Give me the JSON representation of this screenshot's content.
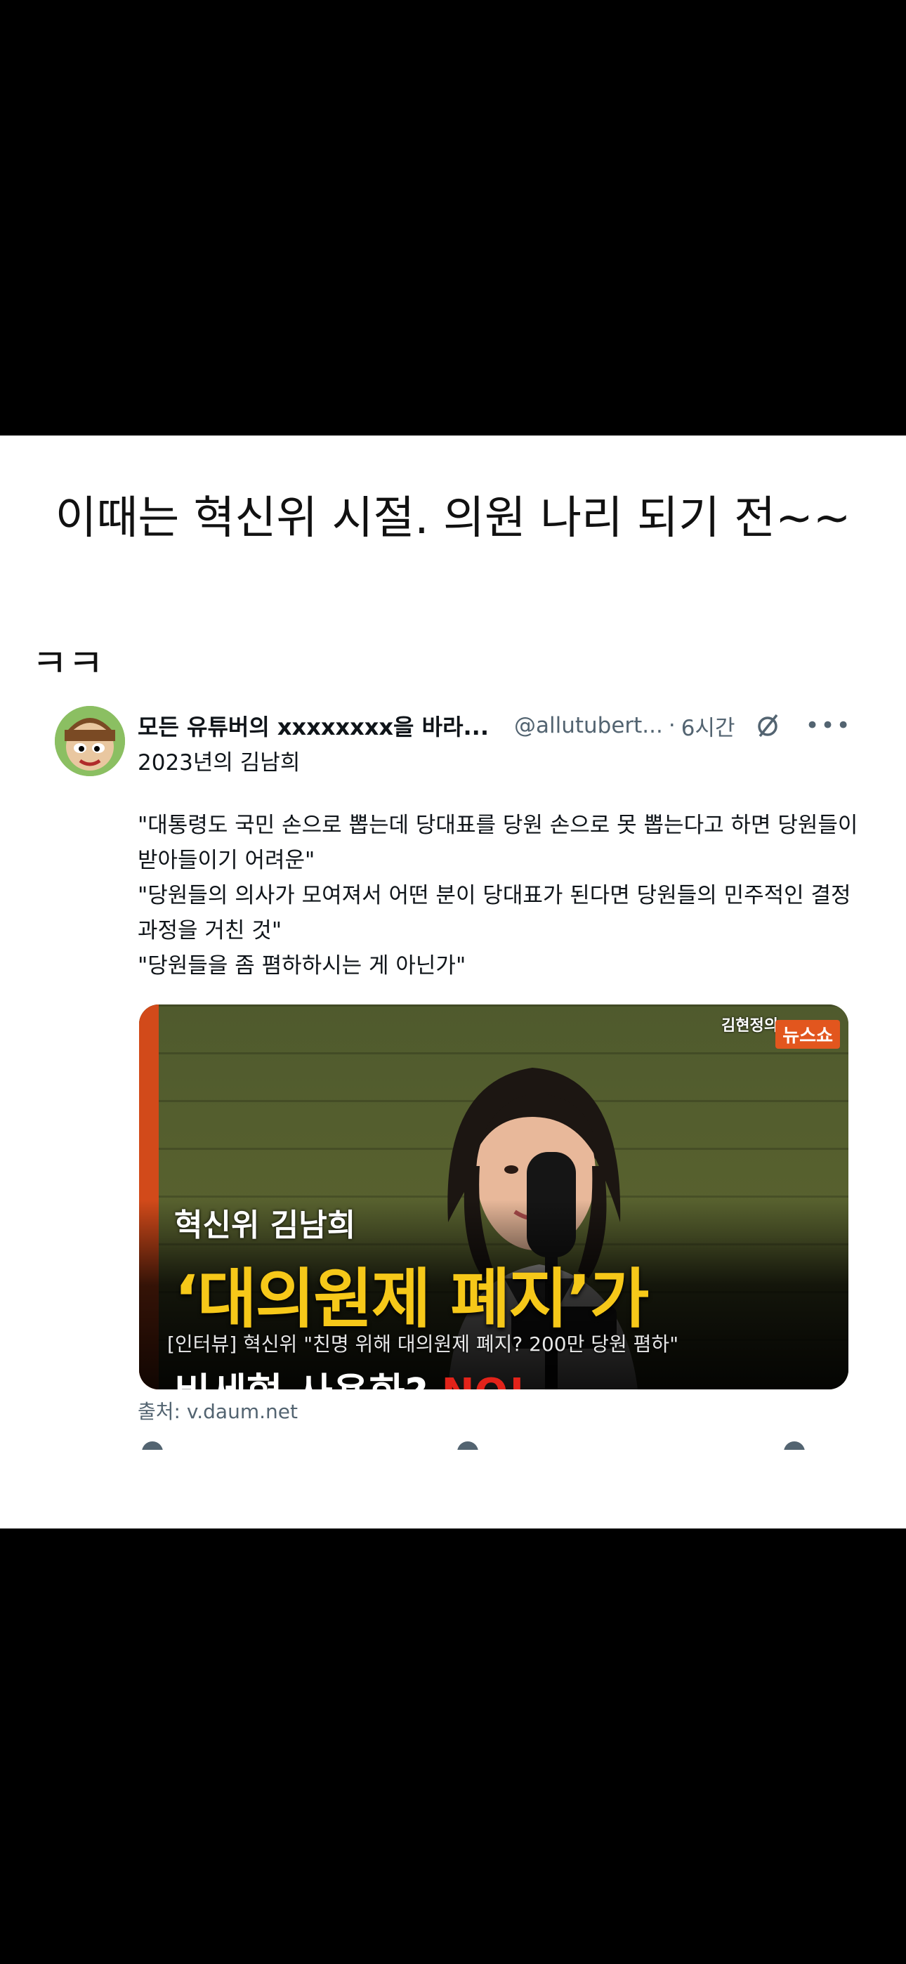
{
  "caption": {
    "main": "이때는 혁신위 시절. 의원 나리 되기 전~~",
    "kk": "ㅋㅋ"
  },
  "tweet": {
    "display_name": "모든 유튜버의 xxxxxxxx을 바라...",
    "handle": "@allutubert...",
    "separator": "·",
    "time": "6시간",
    "subline": "2023년의 김남희",
    "body": [
      "\"대통령도 국민 손으로 뽑는데 당대표를 당원 손으로 못 뽑는다고 하면 당원들이 받아들이기 어려운\"",
      "\"당원들의 의사가 모여져서 어떤 분이 당대표가 된다면 당원들의 민주적인 결정 과정을 거친 것\"",
      "\"당원들을 좀 폄하하시는 게 아닌가\""
    ],
    "media": {
      "host_badge": "김현정의",
      "show_badge": "뉴스쇼",
      "sub_label": "혁신위 김남희",
      "big_label": "‘대의원제 폐지’가",
      "headline": "[인터뷰] 혁신위 \"친명 위해 대의원제 폐지? 200만 당원 폄하\"",
      "cut_text": "비세형 사용화?",
      "cut_no": "NO!"
    },
    "source": "출처: v.daum.net",
    "icons": {
      "grok": "grok-icon",
      "more": "more-icon"
    }
  }
}
